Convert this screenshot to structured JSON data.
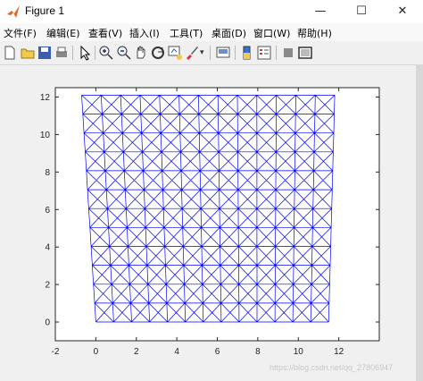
{
  "window": {
    "title": "Figure 1",
    "minimize": "—",
    "maximize": "☐",
    "close": "✕"
  },
  "menu": [
    {
      "label": "文件(F)"
    },
    {
      "label": "编辑(E)"
    },
    {
      "label": "查看(V)"
    },
    {
      "label": "插入(I)"
    },
    {
      "label": "工具(T)"
    },
    {
      "label": "桌面(D)"
    },
    {
      "label": "窗口(W)"
    },
    {
      "label": "帮助(H)"
    }
  ],
  "toolbar": [
    "new-figure-icon",
    "open-file-icon",
    "save-icon",
    "print-icon",
    "edit-plot-arrow-icon",
    "zoom-in-icon",
    "zoom-out-icon",
    "pan-hand-icon",
    "rotate-3d-icon",
    "data-cursor-icon",
    "brush-icon",
    "link-plot-icon",
    "colorbar-icon",
    "legend-icon",
    "hide-plot-tools-icon",
    "show-plot-tools-icon"
  ],
  "colors": {
    "mesh": "#0000ff",
    "axes_bg": "#ffffff",
    "figure_bg": "#f0f0f0"
  },
  "chart_data": {
    "type": "mesh",
    "title": "",
    "xlabel": "",
    "ylabel": "",
    "xlim": [
      -2,
      14
    ],
    "ylim": [
      -1,
      12.5
    ],
    "xticks": [
      "-2",
      "0",
      "2",
      "4",
      "6",
      "8",
      "10",
      "12"
    ],
    "yticks": [
      "0",
      "2",
      "4",
      "6",
      "8",
      "10",
      "12"
    ],
    "grid": false,
    "mesh": {
      "cols": 13,
      "rows": 12,
      "bottom_edge_x": [
        0,
        11.5
      ],
      "top_edge_x": [
        -0.7,
        11.8
      ],
      "y_range": [
        0,
        12.1
      ],
      "diagonals": "both"
    }
  },
  "watermark": "https://blog.csdn.net/qq_27806947"
}
